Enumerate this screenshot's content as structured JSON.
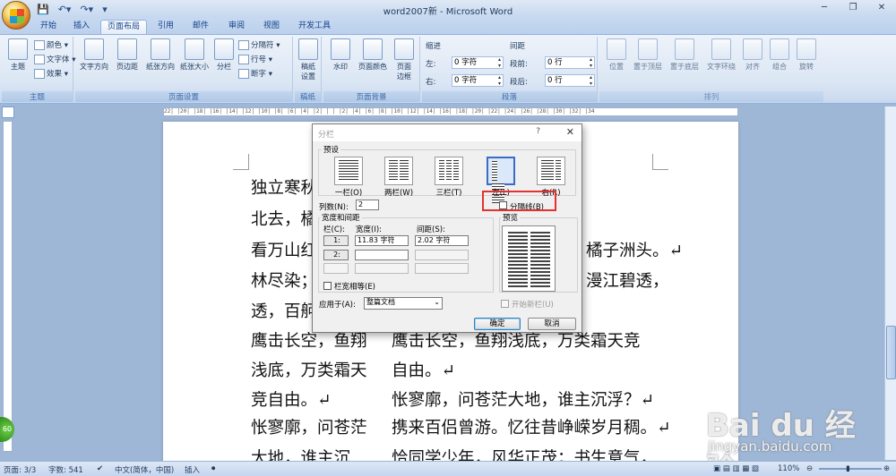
{
  "title": "word2007新 - Microsoft Word",
  "tabs": [
    "开始",
    "插入",
    "页面布局",
    "引用",
    "邮件",
    "审阅",
    "视图",
    "开发工具"
  ],
  "ribbon": {
    "theme": {
      "btn": "主题",
      "colors": "颜色 ▾",
      "fonts": "文字体 ▾",
      "effects": "效果 ▾",
      "label": "主题"
    },
    "page_setup": {
      "text_dir": "文字方向",
      "margins": "页边距",
      "orientation": "纸张方向",
      "size": "纸张大小",
      "columns": "分栏",
      "breaks": "分隔符 ▾",
      "line_num": "行号 ▾",
      "hyphen": "断字 ▾",
      "label": "页面设置"
    },
    "draft": {
      "btn": "稿纸\n设置",
      "label": "稿纸"
    },
    "background": {
      "watermark": "水印",
      "page_color": "页面颜色",
      "borders": "页面\n边框",
      "label": "页面背景"
    },
    "paragraph": {
      "indent": "缩进",
      "left_lab": "左:",
      "left_val": "0 字符",
      "right_lab": "右:",
      "right_val": "0 字符",
      "spacing": "间距",
      "before_lab": "段前:",
      "before_val": "0 行",
      "after_lab": "段后:",
      "after_val": "0 行",
      "label": "段落"
    },
    "arrange": {
      "position": "位置",
      "front": "置于顶层",
      "back": "置于底层",
      "wrap": "文字环绕",
      "align": "对齐",
      "group": "组合",
      "rotate": "旋转",
      "label": "排列"
    }
  },
  "ruler": "22│ │20│ │18│ │16│ │14│ │12│ │10│ │8│ │6│ │4│ │2│ │ │ │2│ │4│ │6│ │8│ │10│ │12│ │14│ │16│ │18│ │20│ │22│ │24│ │26│ │28│ │30│ │32│ │34",
  "doc_left": [
    "独立寒秋",
    "北去，橘",
    "看万山红",
    "林尽染；",
    "透，百舸",
    "鹰击长空，鱼翔",
    "浅底，万类霜天",
    "竞自由。↵",
    "怅寥廓，问苍茫",
    "大地，谁主沉"
  ],
  "doc_right": [
    "橘子洲头。↵",
    "漫江碧透，",
    "鹰击长空，鱼翔浅底，万类霜天竞",
    "自由。↵",
    "怅寥廓，问苍茫大地，谁主沉浮？↵",
    "携来百侣曾游。忆往昔峥嵘岁月稠。↵",
    "恰同学少年，风华正茂；书生意气，"
  ],
  "dialog": {
    "title": "分栏",
    "help": "?",
    "close": "✕",
    "presets_label": "预设",
    "presets": [
      "一栏(O)",
      "两栏(W)",
      "三栏(T)",
      "左(L)",
      "右(R)"
    ],
    "sep_line": "分隔线(B)",
    "cols_label": "列数(N):",
    "cols_val": "2",
    "width_spacing": "宽度和间距",
    "col_lab": "栏(C):",
    "width_lab": "宽度(I):",
    "spacing_lab": "间距(S):",
    "row1": {
      "num": "1:",
      "width": "11.83 字符",
      "spacing": "2.02 字符"
    },
    "row2": {
      "num": "2:"
    },
    "equal": "栏宽相等(E)",
    "apply_lab": "应用于(A):",
    "apply_val": "整篇文档",
    "preview": "预览",
    "new_col": "开始新栏(U)",
    "ok": "确定",
    "cancel": "取消"
  },
  "status": {
    "page": "页面: 3/3",
    "words": "字数: 541",
    "lang": "中文(简体，中国)",
    "mode": "插入",
    "zoom": "110%"
  },
  "watermark": {
    "brand": "Bai du 经验",
    "url": "jingyan.baidu.com"
  },
  "badge": "60"
}
